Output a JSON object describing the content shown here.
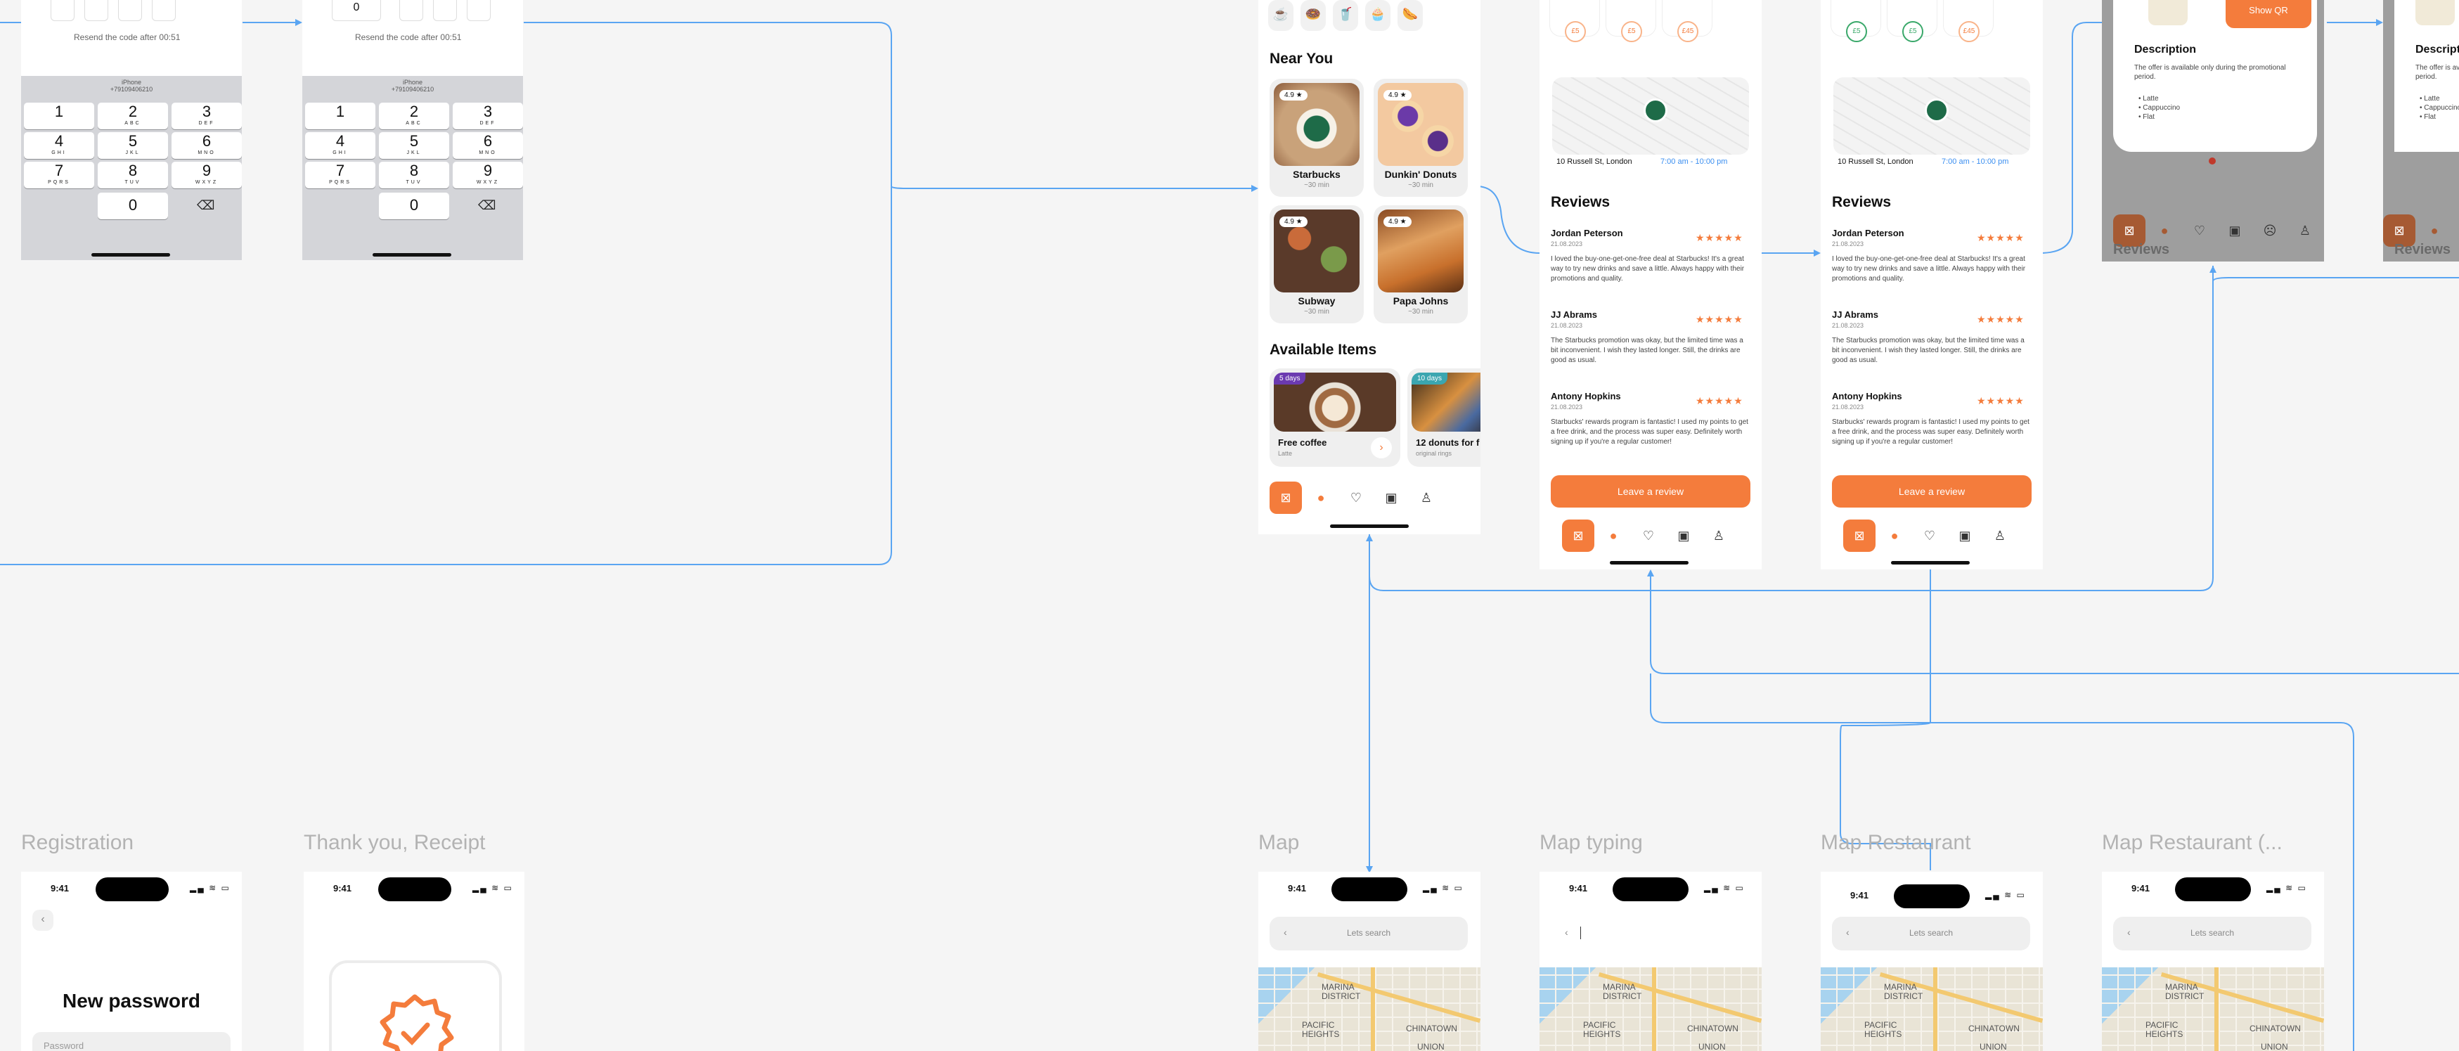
{
  "otp_screen": {
    "resend_text": "Resend the code after 00:51",
    "keyboard_header_line1": "iPhone",
    "keyboard_header_line2": "+79109406210",
    "keys": [
      {
        "digit": "1",
        "letters": ""
      },
      {
        "digit": "2",
        "letters": "ABC"
      },
      {
        "digit": "3",
        "letters": "DEF"
      },
      {
        "digit": "4",
        "letters": "GHI"
      },
      {
        "digit": "5",
        "letters": "JKL"
      },
      {
        "digit": "6",
        "letters": "MNO"
      },
      {
        "digit": "7",
        "letters": "PQRS"
      },
      {
        "digit": "8",
        "letters": "TUV"
      },
      {
        "digit": "9",
        "letters": "WXYZ"
      }
    ],
    "zero": "0",
    "entered_digit": "0"
  },
  "home_screen": {
    "near_you_title": "Near You",
    "available_title": "Available Items",
    "places": [
      {
        "name": "Starbucks",
        "distance": "~30 min",
        "rating": "4.9 ★"
      },
      {
        "name": "Dunkin' Donuts",
        "distance": "~30 min",
        "rating": "4.9 ★"
      },
      {
        "name": "Subway",
        "distance": "~30 min",
        "rating": "4.9 ★"
      },
      {
        "name": "Papa Johns",
        "distance": "~30 min",
        "rating": "4.9 ★"
      }
    ],
    "items": [
      {
        "name": "Free coffee",
        "sub": "Latte",
        "badge": "5 days"
      },
      {
        "name": "12 donuts for f",
        "sub": "original rings",
        "badge": "10 days"
      }
    ]
  },
  "restaurant_screen": {
    "address": "10 Russell St, London",
    "hours": "7:00 am - 10:00 pm",
    "reviews_title": "Reviews",
    "reviews": [
      {
        "name": "Jordan Peterson",
        "date": "21.08.2023",
        "stars": "★★★★★",
        "text": "I loved the buy-one-get-one-free deal at Starbucks! It's a great way to try new drinks and save a little. Always happy with their promotions and quality."
      },
      {
        "name": "JJ Abrams",
        "date": "21.08.2023",
        "stars": "★★★★★",
        "text": "The Starbucks promotion was okay, but the limited time was a bit inconvenient. I wish they lasted longer. Still, the drinks are good as usual."
      },
      {
        "name": "Antony Hopkins",
        "date": "21.08.2023",
        "stars": "★★★★★",
        "text": "Starbucks' rewards program is fantastic! I used my points to get a free drink, and the process was super easy. Definitely worth signing up if you're a regular customer!"
      }
    ],
    "leave_review": "Leave a review",
    "codes_a": [
      "£5",
      "£5",
      "£45"
    ],
    "codes_b": [
      "£5",
      "£5",
      "£45"
    ]
  },
  "offer_screen": {
    "show_qr": "Show QR",
    "description_title": "Description",
    "description_text": "The offer is available only during the promotional period.",
    "bullets": [
      "Latte",
      "Cappuccino",
      "Flat"
    ],
    "reviews_partial": "Reviews"
  },
  "frame_labels": {
    "registration": "Registration",
    "thank_you": "Thank you, Receipt",
    "map": "Map",
    "map_typing": "Map typing",
    "map_restaurant": "Map Restaurant",
    "map_restaurant_2": "Map Restaurant (..."
  },
  "registration": {
    "time": "9:41",
    "title": "New password",
    "field_placeholder": "Password"
  },
  "thank_you": {
    "time": "9:41"
  },
  "maps": {
    "time": "9:41",
    "search_placeholder": "Lets search",
    "districts": [
      "MARINA DISTRICT",
      "PACIFIC HEIGHTS",
      "CHINATOWN",
      "UNION"
    ]
  },
  "colors": {
    "accent": "#f47c3c",
    "wire": "#4a9cf0",
    "canvas": "#f5f5f5"
  }
}
